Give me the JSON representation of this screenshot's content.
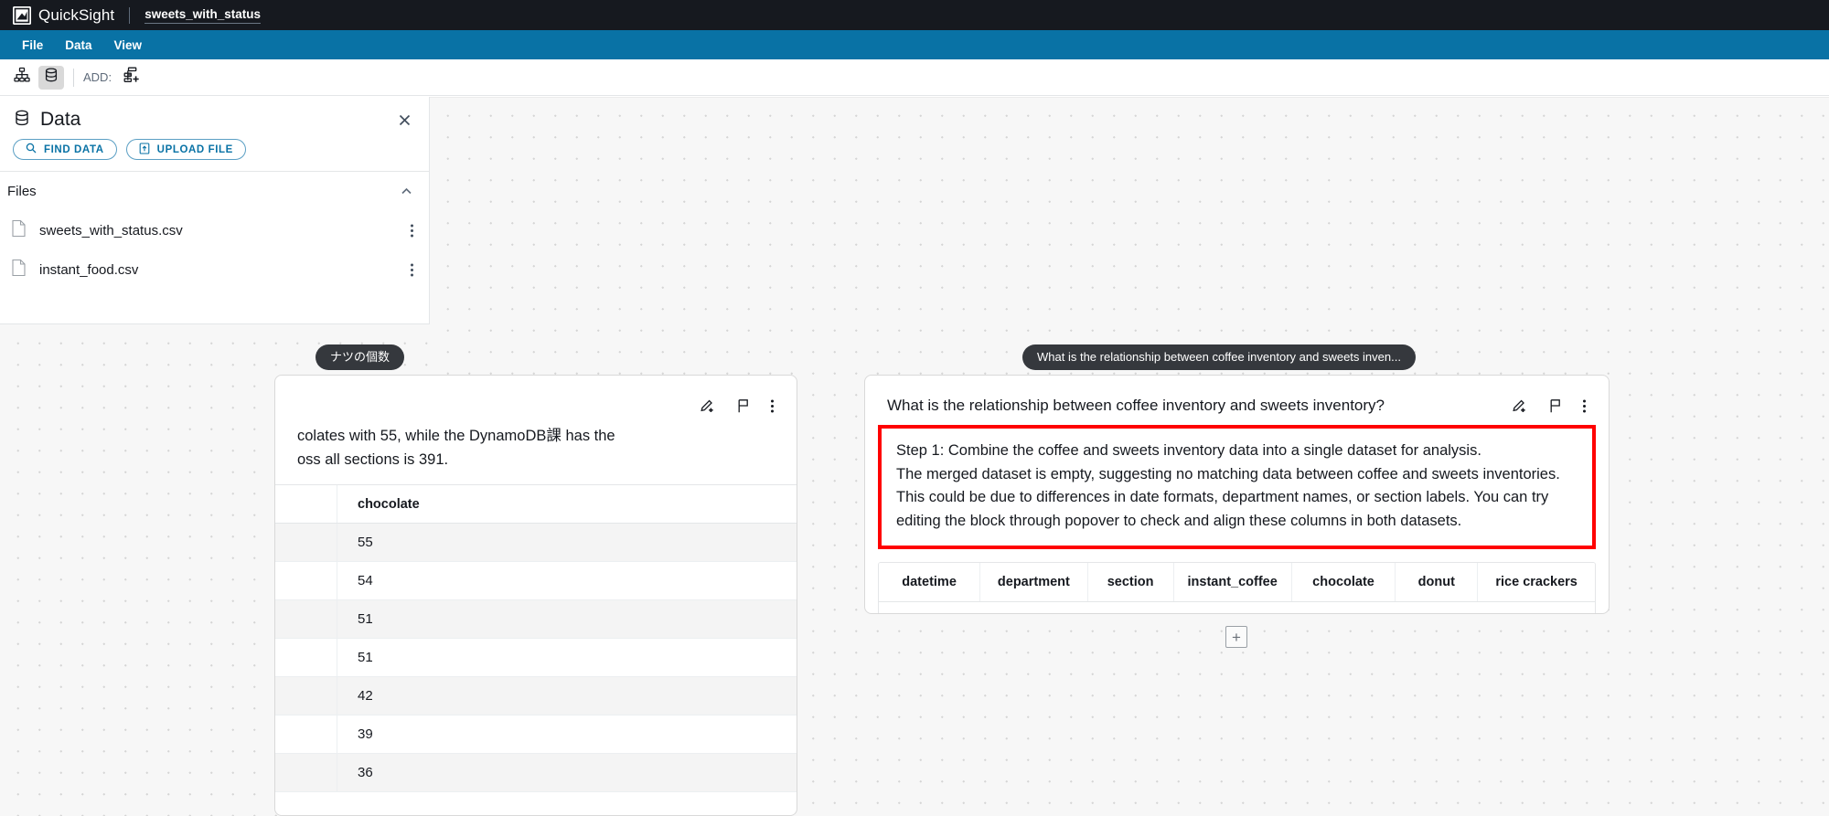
{
  "topbar": {
    "logo_icon": "quicksight-logo-icon",
    "product_name": "QuickSight",
    "document_name": "sweets_with_status"
  },
  "menubar": {
    "items": [
      {
        "label": "File"
      },
      {
        "label": "Data"
      },
      {
        "label": "View"
      }
    ]
  },
  "toolbar": {
    "flow_icon": "hierarchy-icon",
    "data_icon": "database-icon",
    "add_label": "ADD:",
    "add_icon": "add-block-icon"
  },
  "data_panel": {
    "header_icon": "database-icon",
    "title": "Data",
    "close_icon": "close-icon",
    "find_data_label": "FIND DATA",
    "find_data_icon": "search-icon",
    "upload_file_label": "UPLOAD FILE",
    "upload_file_icon": "upload-file-icon",
    "files_section": {
      "title": "Files",
      "collapse_icon": "chevron-up-icon",
      "items": [
        {
          "name": "sweets_with_status.csv",
          "file_icon": "file-icon",
          "more_icon": "more-vertical-icon"
        },
        {
          "name": "instant_food.csv",
          "file_icon": "file-icon",
          "more_icon": "more-vertical-icon"
        }
      ]
    }
  },
  "canvas": {
    "left_card": {
      "pill_label": "ナツの個数",
      "icons": [
        "edit-icon",
        "flag-icon",
        "more-vertical-icon"
      ],
      "text_line_1": "colates with 55, while the DynamoDB課 has the",
      "text_line_2": "oss all sections is 391.",
      "table": {
        "header": "chocolate",
        "values": [
          "55",
          "54",
          "51",
          "51",
          "42",
          "39",
          "36"
        ]
      }
    },
    "right_card": {
      "pill_label": "What is the relationship between coffee inventory and sweets inven...",
      "question": "What is the relationship between coffee inventory and sweets inventory?",
      "icons": [
        "edit-icon",
        "flag-icon",
        "more-vertical-icon"
      ],
      "highlight_color": "#ff0000",
      "answer_lines": [
        "Step 1: Combine the coffee and sweets inventory data into a single dataset for analysis.",
        "The merged dataset is empty, suggesting no matching data between coffee and sweets inventories.",
        "This could be due to differences in date formats, department names, or section labels. You can try",
        "editing the block through popover to check and align these columns in both datasets."
      ],
      "table": {
        "columns": [
          "datetime",
          "department",
          "section",
          "instant_coffee",
          "chocolate",
          "donut",
          "rice crackers"
        ],
        "rows": []
      }
    },
    "add_block_button": {
      "icon": "plus-icon",
      "label": "+"
    }
  },
  "colors": {
    "topbar_bg": "#16191f",
    "menubar_bg": "#0972a5",
    "accent_link": "#0972a5",
    "highlight": "#ff0000",
    "canvas_bg": "#f7f7f7"
  }
}
